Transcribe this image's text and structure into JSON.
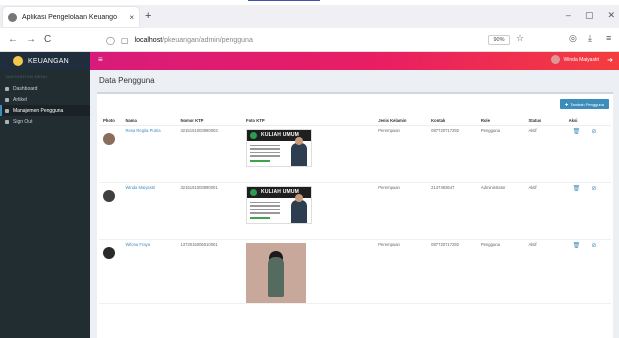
{
  "browser": {
    "tab_title": "Aplikasi Pengelolaan Keuango",
    "tab_close": "×",
    "new_tab": "+",
    "url_host": "localhost",
    "url_path": "/pkeuangan/admin/pengguna",
    "zoom": "90%",
    "back": "←",
    "forward": "→",
    "reload": "C",
    "window_minimize": "–",
    "window_restore": "▢",
    "window_close": "✕"
  },
  "app": {
    "brand": "KEUANGAN",
    "hamburger": "≡",
    "user_name": "Winda Maiyastri",
    "logout_icon": "➜"
  },
  "sidebar": {
    "header": "NAVIGATION MENU",
    "items": [
      {
        "label": "Dashboard"
      },
      {
        "label": "Artikel"
      },
      {
        "label": "Manajemen Pengguna"
      },
      {
        "label": "Sign Out"
      }
    ]
  },
  "page": {
    "title": "Data Pengguna",
    "add_button": "Tambah Pengguna"
  },
  "table": {
    "headers": [
      "Photo",
      "Nama",
      "Nomor KTP",
      "Foto KTP",
      "Jenis Kelamin",
      "Kontak",
      "Role",
      "Status",
      "Aksi"
    ],
    "ktp_heading": "KULIAH UMUM",
    "rows": [
      {
        "nama": "Resa Regita Putria",
        "ktp": "3215151003990003",
        "jenis_kelamin": "Perempuan",
        "kontak": "087720717292",
        "role": "Pengguna",
        "status": "Aktif"
      },
      {
        "nama": "Winda Maiyastri",
        "ktp": "3215151003990001",
        "jenis_kelamin": "Perempuan",
        "kontak": "2147483647",
        "role": "Administrator",
        "status": "Aktif"
      },
      {
        "nama": "Wilona Fraya",
        "ktp": "1373015006010001",
        "jenis_kelamin": "Perempuan",
        "kontak": "087720717292",
        "role": "Pengguna",
        "status": "Aktif"
      }
    ]
  },
  "icons": {
    "delete": "trash-icon",
    "edit": "edit-icon"
  },
  "colors": {
    "brand_bg": "#1f2d3d",
    "topbar_start": "#d81b7a",
    "topbar_end": "#f43d3d",
    "sidebar_bg": "#222d32",
    "accent": "#3c8dbc"
  }
}
